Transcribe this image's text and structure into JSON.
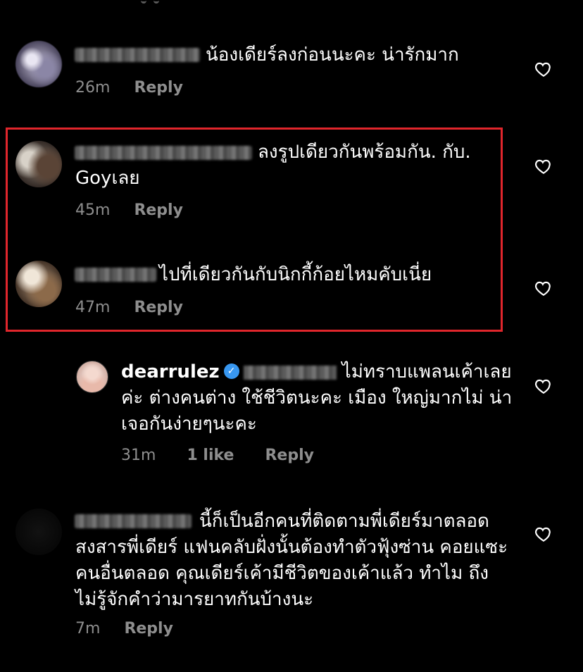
{
  "comments": [
    {
      "username": "",
      "text": "น้องเดียร์ลงก่อนนะคะ น่ารักมาก",
      "time": "26m",
      "reply_label": "Reply"
    },
    {
      "username": "",
      "text": "ลงรูปเดียวกันพร้อมกัน. กับ. Goyเลย",
      "time": "45m",
      "reply_label": "Reply"
    },
    {
      "username": "",
      "text": "ไปที่เดียวกันกับนิกกี้ก้อยไหมคับเนี่ย",
      "time": "47m",
      "reply_label": "Reply"
    },
    {
      "username": "dearrulez",
      "verified": true,
      "text": "ไม่ทราบแพลนเค้าเลยค่ะ ต่างคนต่าง ใช้ชีวิตนะคะ เมือง ใหญ่มากไม่ น่าเจอกันง่ายๆนะคะ",
      "time": "31m",
      "likes": "1 like",
      "reply_label": "Reply"
    },
    {
      "username": "",
      "text": "นี้ก็เป็นอีกคนที่ติดตามพี่เดียร์มาตลอด สงสารพี่เดียร์ แฟนคลับฝั่งนั้นต้องทำตัวฟุ้งซ่าน คอยแซะคนอื่นตลอด คุณเดียร์เค้ามีชีวิตของเค้าแล้ว ทำไม ถึงไม่รู้จักคำว่ามารยาทกันบ้างนะ",
      "time": "7m",
      "reply_label": "Reply"
    }
  ],
  "icons": {
    "like": "heart-outline-icon",
    "verified": "verified-badge-icon"
  },
  "colors": {
    "background": "#000000",
    "text": "#ffffff",
    "meta": "#8e8e8e",
    "highlight": "#e0262c",
    "verified": "#3897f0"
  }
}
